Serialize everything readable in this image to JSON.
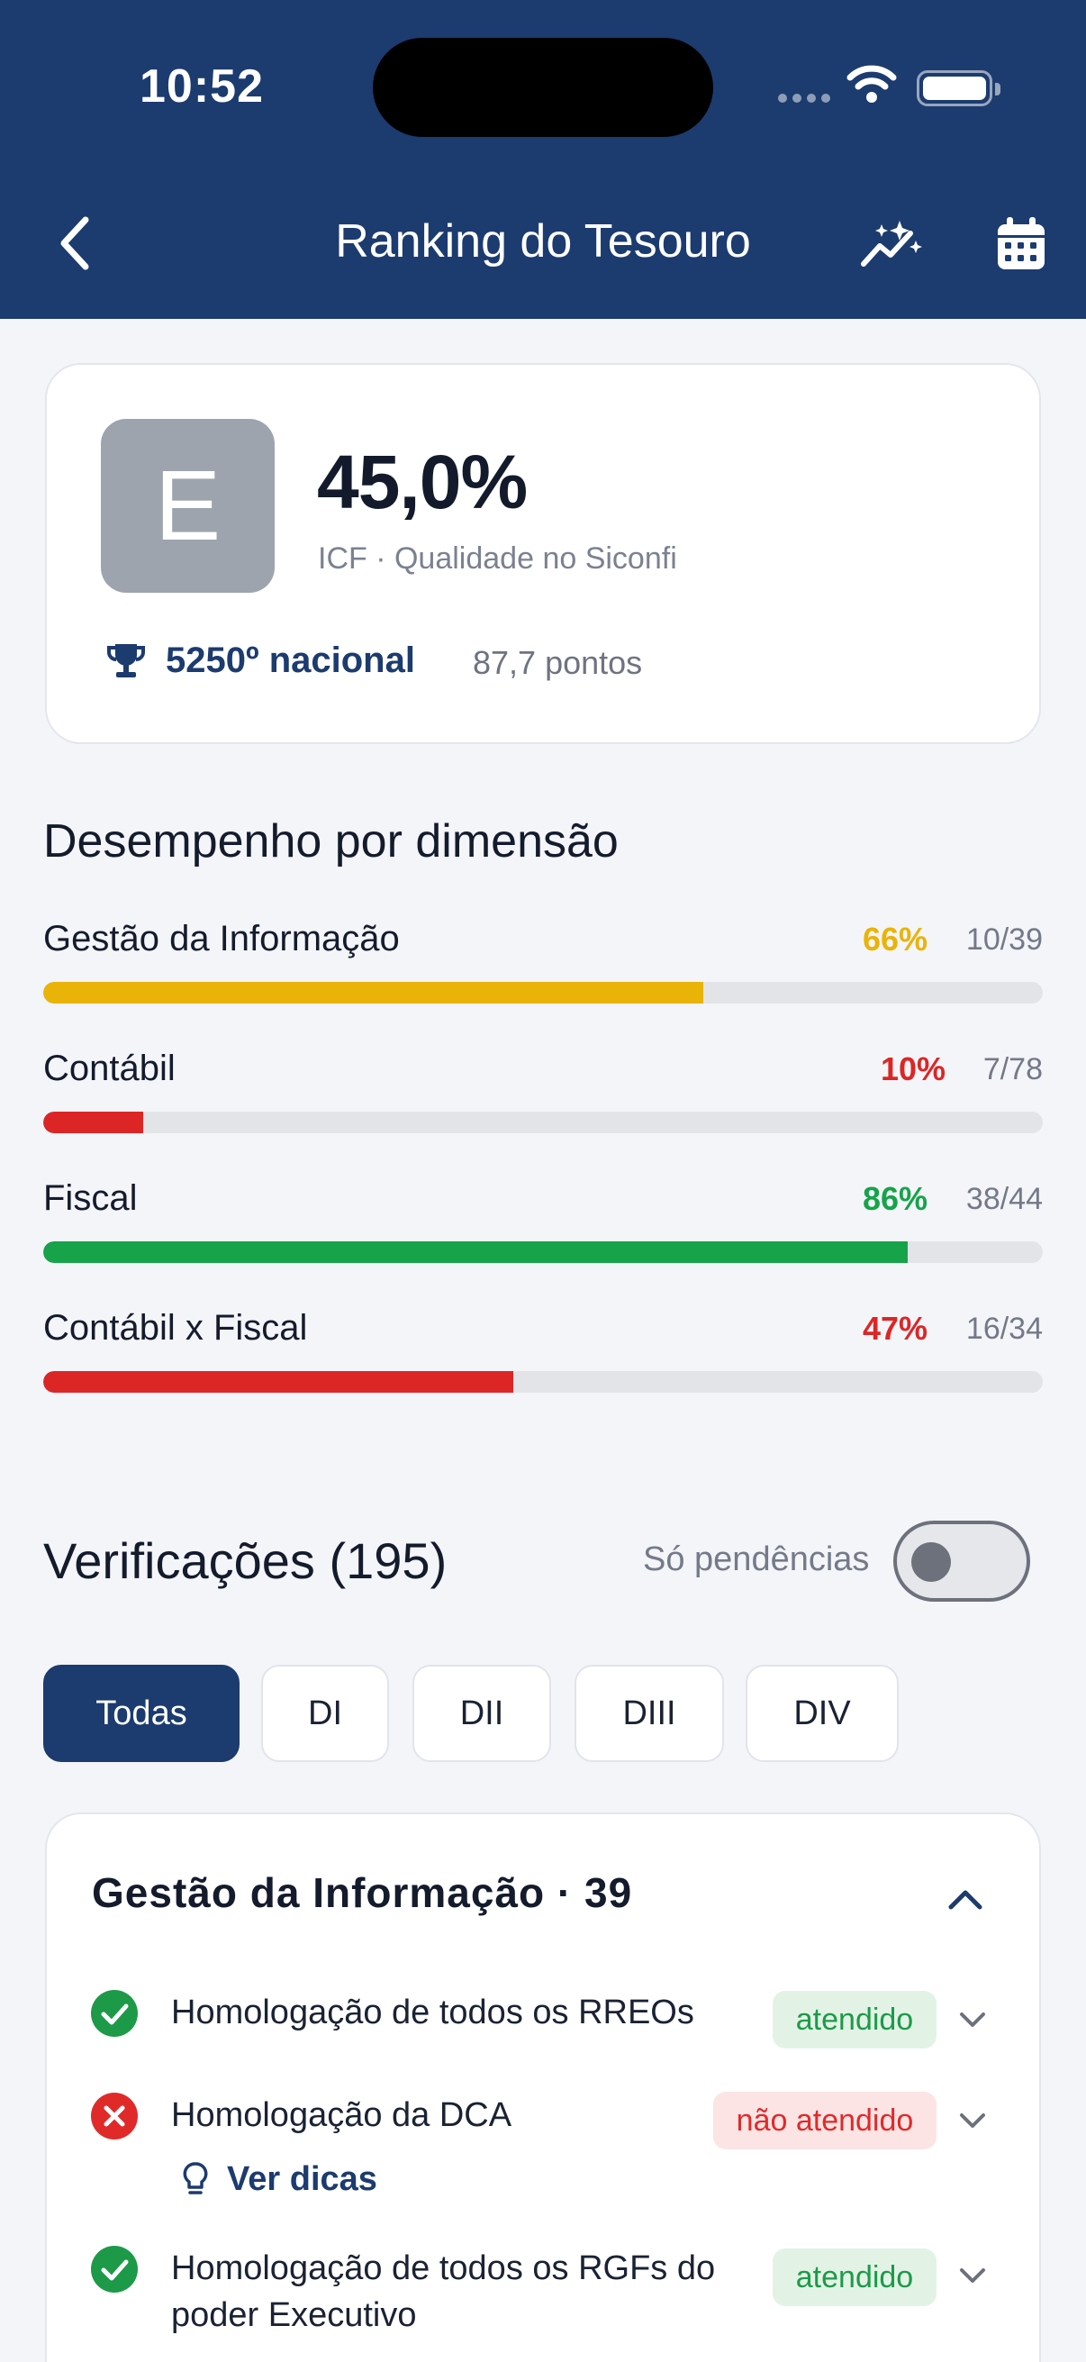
{
  "status_bar": {
    "time": "10:52"
  },
  "header": {
    "title": "Ranking do Tesouro",
    "back_icon": "chevron-left-icon",
    "trend_icon": "sparkle-trend-icon",
    "calendar_icon": "calendar-icon"
  },
  "score": {
    "grade": "E",
    "percent": "45,0%",
    "subtitle": "ICF · Qualidade no Siconfi",
    "rank": "5250º nacional",
    "points": "87,7 pontos"
  },
  "dimensions": {
    "title": "Desempenho por dimensão",
    "items": [
      {
        "name": "Gestão da Informação",
        "percent_label": "66%",
        "count": "10/39",
        "fill": 0.66,
        "color": "#eab308"
      },
      {
        "name": "Contábil",
        "percent_label": "10%",
        "count": "7/78",
        "fill": 0.1,
        "color": "#dc2626"
      },
      {
        "name": "Fiscal",
        "percent_label": "86%",
        "count": "38/44",
        "fill": 0.865,
        "color": "#16a34a"
      },
      {
        "name": "Contábil x Fiscal",
        "percent_label": "47%",
        "count": "16/34",
        "fill": 0.47,
        "color": "#dc2626"
      }
    ]
  },
  "verifications": {
    "title": "Verificações (195)",
    "toggle_label": "Só pendências",
    "toggle_on": false,
    "filters": [
      "Todas",
      "DI",
      "DII",
      "DIII",
      "DIV"
    ],
    "active_filter": "Todas",
    "group": {
      "title": "Gestão da Informação · 39",
      "items": [
        {
          "label": "Homologação de todos os RREOs",
          "status": "atendido",
          "ok": true
        },
        {
          "label": "Homologação da DCA",
          "status": "não atendido",
          "ok": false,
          "tips": "Ver dicas"
        },
        {
          "label": "Homologação de todos os RGFs do poder Executivo",
          "status": "atendido",
          "ok": true
        }
      ]
    }
  },
  "colors": {
    "brand": "#1c3b6f",
    "ok": "#1d9a48",
    "error": "#e02a2a"
  }
}
